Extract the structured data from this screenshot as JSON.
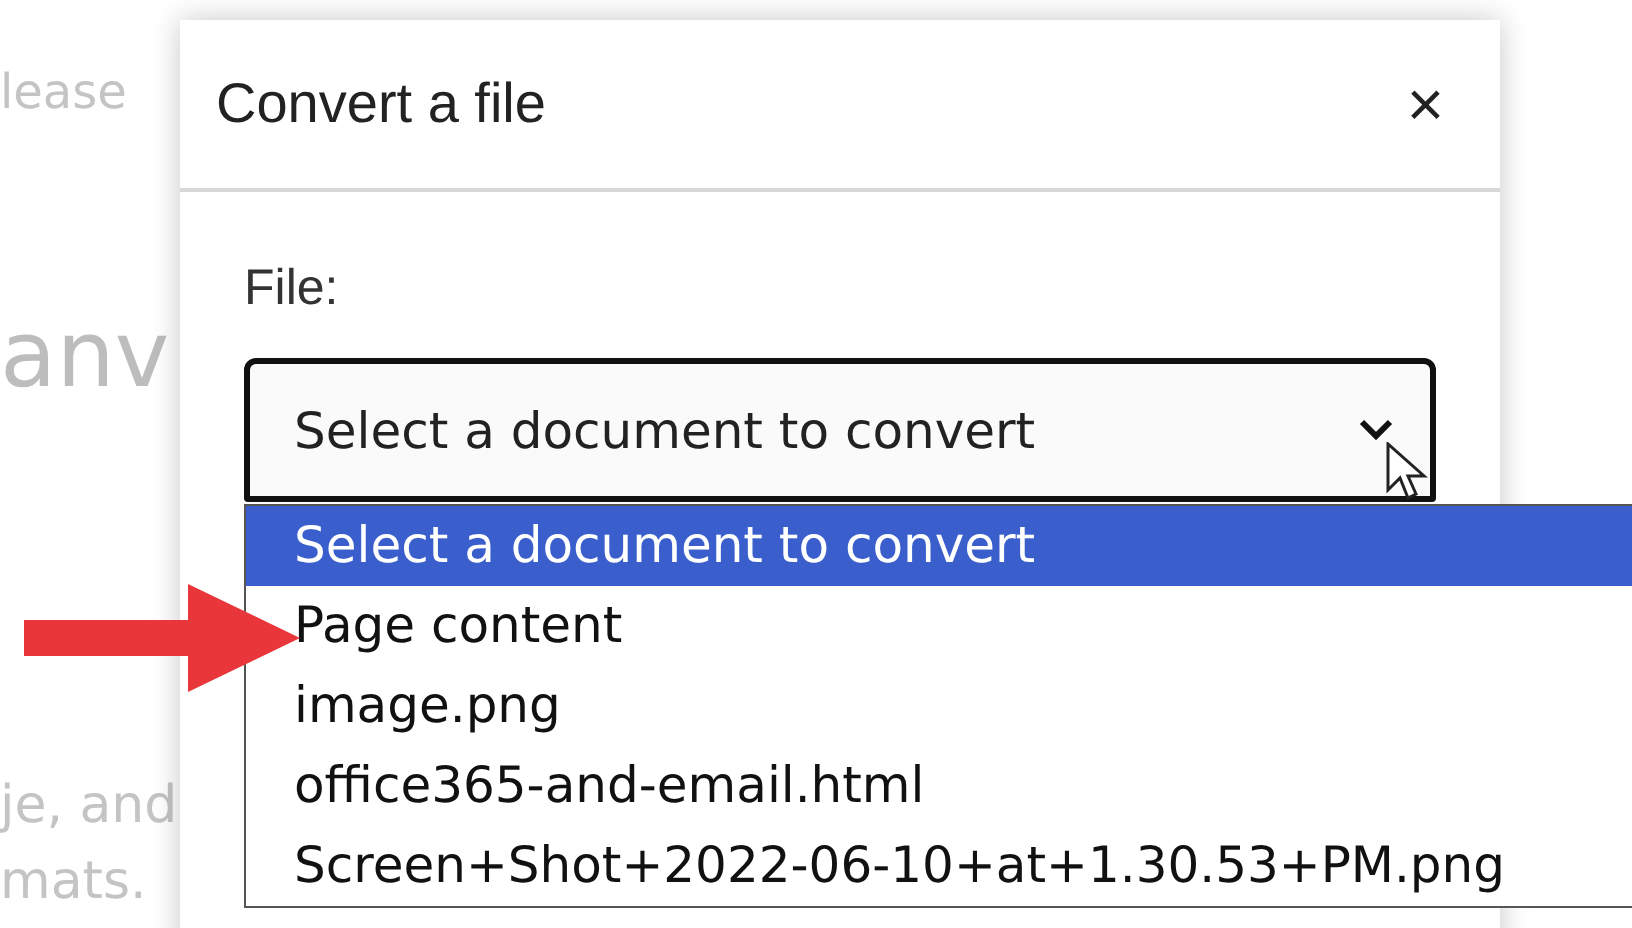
{
  "background_text": [
    "lease",
    "anv",
    "je, and",
    "mats."
  ],
  "dialog": {
    "title": "Convert a file",
    "close": "×",
    "field_label": "File:",
    "select": {
      "value": "Select a document to convert",
      "expanded": true,
      "options": [
        {
          "label": "Select a document to convert",
          "selected": true
        },
        {
          "label": "Page content",
          "selected": false
        },
        {
          "label": "image.png",
          "selected": false
        },
        {
          "label": "office365-and-email.html",
          "selected": false
        },
        {
          "label": "Screen+Shot+2022-06-10+at+1.30.53+PM.png",
          "selected": false
        }
      ]
    }
  }
}
